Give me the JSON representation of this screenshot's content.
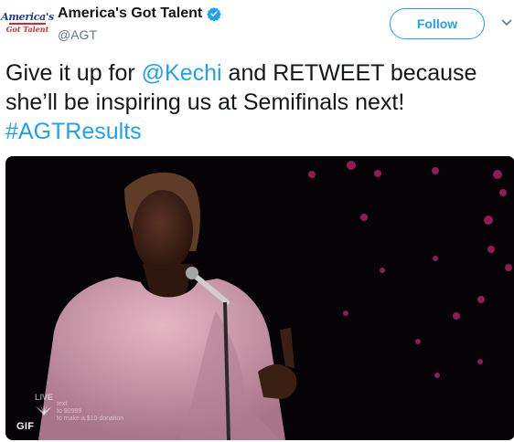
{
  "account": {
    "logo_text": "America's",
    "logo_subtext": "Got Talent",
    "display_name": "America's Got Talent",
    "handle": "@AGT",
    "verified": true
  },
  "follow_button": {
    "label": "Follow"
  },
  "tweet": {
    "text_before": "Give it up for ",
    "mention": "@Kechi",
    "text_after": " and RETWEET because she’ll be inspiring us at Semifinals next! ",
    "hashtag": "#AGTResults"
  },
  "media": {
    "type_badge": "GIF",
    "live_label": "LIVE",
    "donation_line1": "text",
    "donation_line2": "to 90999",
    "donation_line3": "to make a $10 donation"
  },
  "colors": {
    "link": "#1da1f2",
    "verified_badge": "#1da1f2",
    "dress": "#d9a6b6",
    "background": "#060306"
  },
  "icons": {
    "verified": "verified-badge-icon",
    "caret": "chevron-down-icon",
    "network": "nbc-peacock-icon"
  }
}
